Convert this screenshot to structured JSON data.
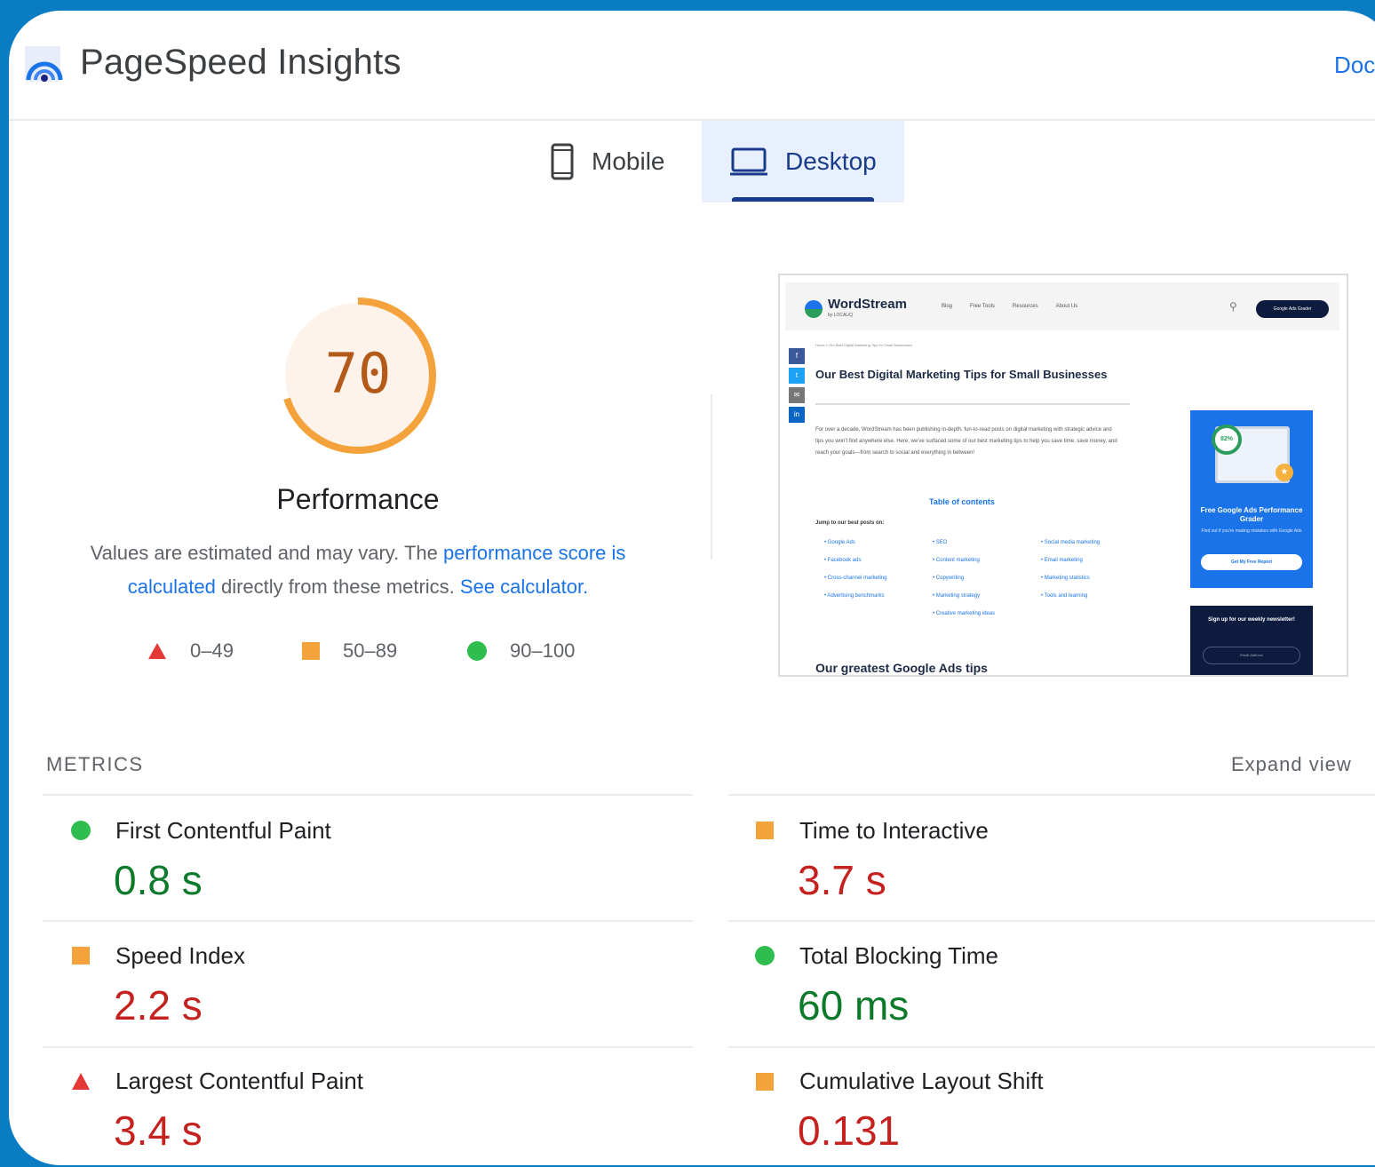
{
  "header": {
    "title": "PageSpeed Insights",
    "docs_link": "Doc"
  },
  "tabs": [
    {
      "label": "Mobile",
      "selected": false
    },
    {
      "label": "Desktop",
      "selected": true
    }
  ],
  "performance": {
    "score": "70",
    "score_value": 70,
    "score_color": "#f4a23b",
    "title": "Performance",
    "desc_prefix": "Values are estimated and may vary. The ",
    "desc_link1": "performance score is calculated",
    "desc_middle": " directly from these metrics. ",
    "desc_link2": "See calculator."
  },
  "legend": [
    {
      "range": "0–49",
      "shape": "triangle",
      "color": "#e53935"
    },
    {
      "range": "50–89",
      "shape": "square",
      "color": "#f4a23b"
    },
    {
      "range": "90–100",
      "shape": "circle",
      "color": "#2ebd4e"
    }
  ],
  "screenshot": {
    "brand": "WordStream",
    "brand_sub": "by LOCALiQ",
    "menu": [
      "Blog",
      "Free Tools",
      "Resources",
      "About Us"
    ],
    "cta": "Google Ads Grader",
    "breadcrumb": "Home » Our Best Digital Marketing Tips for Small Businesses",
    "heading": "Our Best Digital Marketing Tips for Small Businesses",
    "body": "For over a decade, WordStream has been publishing in-depth, fun-to-read posts on digital marketing with strategic advice and tips you won't find anywhere else. Here, we've surfaced some of our best marketing tips to help you save time, save money, and reach your goals—from search to social and everything in between!",
    "toc": "Table of contents",
    "jump": "Jump to our best posts on:",
    "col1": [
      "• Google Ads",
      "• Facebook ads",
      "• Cross-channel marketing",
      "• Advertising benchmarks"
    ],
    "col2": [
      "• SEO",
      "• Content marketing",
      "• Copywriting",
      "• Marketing strategy",
      "• Creative marketing ideas"
    ],
    "col3": [
      "• Social media marketing",
      "• Email marketing",
      "• Marketing statistics",
      "• Tools and learning"
    ],
    "tips_heading": "Our greatest Google Ads tips",
    "ad_badge": "82%",
    "ad_title": "Free Google Ads Performance Grader",
    "ad_sub": "Find out if you're making mistakes with Google Ads",
    "ad_button": "Get My Free Report",
    "news_title": "Sign up for our weekly newsletter!",
    "news_field": "Email Address"
  },
  "metrics": {
    "label": "METRICS",
    "expand": "Expand view",
    "items": [
      {
        "name": "First Contentful Paint",
        "value": "0.8 s",
        "status": "pass"
      },
      {
        "name": "Time to Interactive",
        "value": "3.7 s",
        "status": "average"
      },
      {
        "name": "Speed Index",
        "value": "2.2 s",
        "status": "average"
      },
      {
        "name": "Total Blocking Time",
        "value": "60 ms",
        "status": "pass"
      },
      {
        "name": "Largest Contentful Paint",
        "value": "3.4 s",
        "status": "fail"
      },
      {
        "name": "Cumulative Layout Shift",
        "value": "0.131",
        "status": "average"
      }
    ]
  }
}
